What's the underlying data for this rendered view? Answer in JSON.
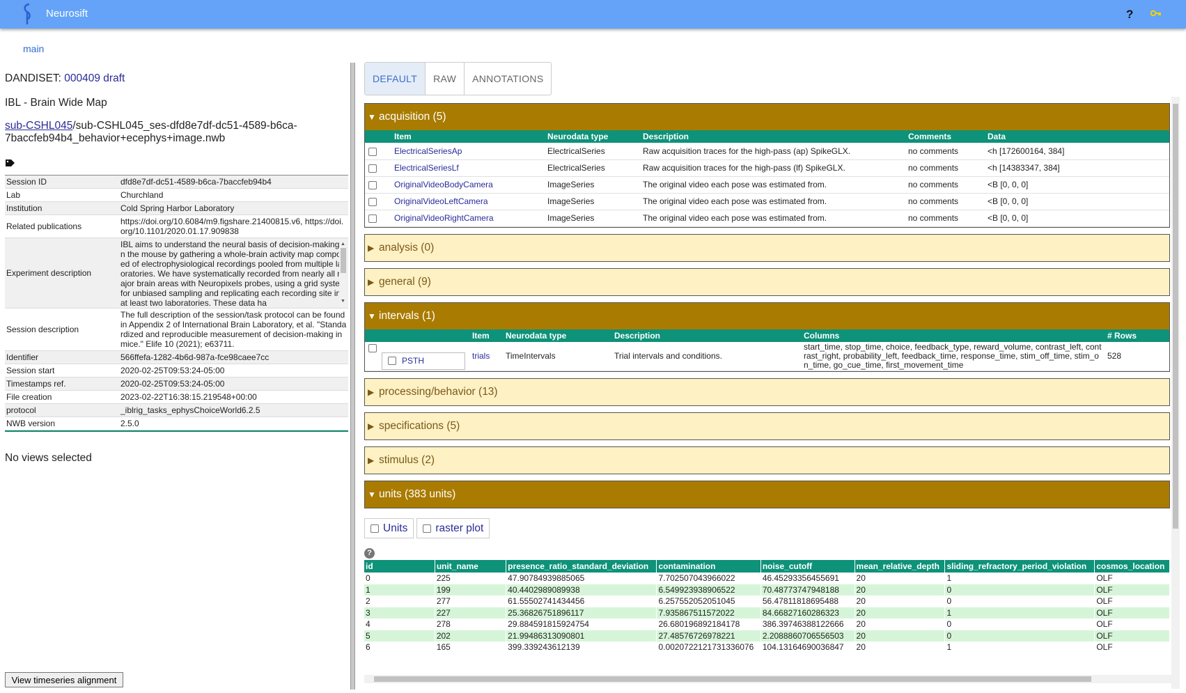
{
  "app": {
    "name": "Neurosift",
    "help": "?",
    "branch": "main"
  },
  "left": {
    "dandiset_label": "DANDISET:",
    "dandiset_link": "000409 draft",
    "title": "IBL - Brain Wide Map",
    "subject_link": "sub-CSHL045",
    "file_rest": "/sub-CSHL045_ses-dfd8e7df-dc51-4589-b6ca-7baccfeb94b4_behavior+ecephys+image.nwb",
    "meta": [
      {
        "k": "Session ID",
        "v": "dfd8e7df-dc51-4589-b6ca-7baccfeb94b4"
      },
      {
        "k": "Lab",
        "v": "Churchland"
      },
      {
        "k": "Institution",
        "v": "Cold Spring Harbor Laboratory"
      },
      {
        "k": "Related publications",
        "v": "https://doi.org/10.6084/m9.figshare.21400815.v6, https://doi.org/10.1101/2020.01.17.909838"
      },
      {
        "k": "Experiment description",
        "v": "IBL aims to understand the neural basis of decision-making in the mouse by gathering a whole-brain activity map composed of electrophysiological recordings pooled from multiple laboratories. We have systematically recorded from nearly all major brain areas with Neuropixels probes, using a grid system for unbiased sampling and replicating each recording site in at least two laboratories. These data ha"
      },
      {
        "k": "Session description",
        "v": "The full description of the session/task protocol can be found in Appendix 2 of International Brain Laboratory, et al. \"Standardized and reproducible measurement of decision-making in mice.\" Elife 10 (2021); e63711."
      },
      {
        "k": "Identifier",
        "v": "566ffefa-1282-4b6d-987a-fce98caee7cc"
      },
      {
        "k": "Session start",
        "v": "2020-02-25T09:53:24-05:00"
      },
      {
        "k": "Timestamps ref.",
        "v": "2020-02-25T09:53:24-05:00"
      },
      {
        "k": "File creation",
        "v": "2023-02-22T16:38:15.219548+00:00"
      },
      {
        "k": "protocol",
        "v": "_iblrig_tasks_ephysChoiceWorld6.2.5"
      },
      {
        "k": "NWB version",
        "v": "2.5.0"
      }
    ],
    "no_views": "No views selected",
    "timeseries_button": "View timeseries alignment"
  },
  "tabs": [
    "DEFAULT",
    "RAW",
    "ANNOTATIONS"
  ],
  "acquisition": {
    "header": "acquisition (5)",
    "columns": [
      "Item",
      "Neurodata type",
      "Description",
      "Comments",
      "Data"
    ],
    "rows": [
      [
        "ElectricalSeriesAp",
        "ElectricalSeries",
        "Raw acquisition traces for the high-pass (ap) SpikeGLX.",
        "no comments",
        "<h [172600164, 384]"
      ],
      [
        "ElectricalSeriesLf",
        "ElectricalSeries",
        "Raw acquisition traces for the high-pass (lf) SpikeGLX.",
        "no comments",
        "<h [14383347, 384]"
      ],
      [
        "OriginalVideoBodyCamera",
        "ImageSeries",
        "The original video each pose was estimated from.",
        "no comments",
        "<B [0, 0, 0]"
      ],
      [
        "OriginalVideoLeftCamera",
        "ImageSeries",
        "The original video each pose was estimated from.",
        "no comments",
        "<B [0, 0, 0]"
      ],
      [
        "OriginalVideoRightCamera",
        "ImageSeries",
        "The original video each pose was estimated from.",
        "no comments",
        "<B [0, 0, 0]"
      ]
    ]
  },
  "sections": {
    "analysis": "analysis (0)",
    "general": "general (9)",
    "intervals": "intervals (1)",
    "processing": "processing/behavior (13)",
    "specifications": "specifications (5)",
    "stimulus": "stimulus (2)",
    "units": "units (383 units)"
  },
  "intervals": {
    "columns": [
      "Item",
      "Neurodata type",
      "Description",
      "Columns",
      "# Rows"
    ],
    "psth": "PSTH",
    "item": "trials",
    "type": "TimeIntervals",
    "description": "Trial intervals and conditions.",
    "cols": "start_time, stop_time, choice, feedback_type, reward_volume, contrast_left, contrast_right, probability_left, feedback_time, response_time, stim_off_time, stim_on_time, go_cue_time, first_movement_time",
    "nrows": "528"
  },
  "units": {
    "buttons": [
      "Units",
      "raster plot"
    ],
    "columns": [
      "id",
      "unit_name",
      "presence_ratio_standard_deviation",
      "contamination",
      "noise_cutoff",
      "mean_relative_depth",
      "sliding_refractory_period_violation",
      "cosmos_location"
    ],
    "rows": [
      [
        "0",
        "225",
        "47.90784939885065",
        "7.702507043966022",
        "46.45293356455691",
        "20",
        "1",
        "OLF"
      ],
      [
        "1",
        "199",
        "40.4402989089938",
        "6.549923938906522",
        "70.48773747948188",
        "20",
        "0",
        "OLF"
      ],
      [
        "2",
        "277",
        "61.55502741434456",
        "6.257552052051045",
        "56.47811818695488",
        "20",
        "0",
        "OLF"
      ],
      [
        "3",
        "227",
        "25.36826751896117",
        "7.935867511572022",
        "84.66827160286323",
        "20",
        "1",
        "OLF"
      ],
      [
        "4",
        "278",
        "29.884591815924754",
        "26.680196892184178",
        "386.39746388122666",
        "20",
        "0",
        "OLF"
      ],
      [
        "5",
        "202",
        "21.99486313090801",
        "27.48576726978221",
        "2.2088860706556503",
        "20",
        "0",
        "OLF"
      ],
      [
        "6",
        "165",
        "399.339243612139",
        "0.0020722121731336076",
        "104.13164690036847",
        "20",
        "1",
        "OLF"
      ]
    ]
  }
}
